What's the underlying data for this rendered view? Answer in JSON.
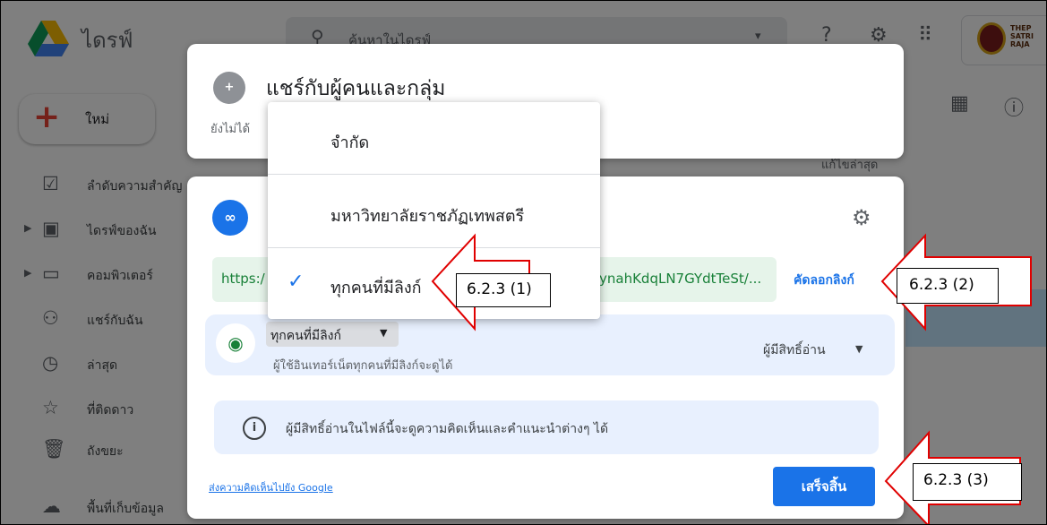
{
  "drive": {
    "app_name": "ไดรฟ์",
    "search_placeholder": "ค้นหาในไดรฟ์",
    "new_button": "ใหม่",
    "university_logo": "เทพสตรี THEPSATRI RAJABHAT UNIVERSITY",
    "sidebar": [
      {
        "label": "ลำดับความสำคัญ",
        "icon": "priority-icon"
      },
      {
        "label": "ไดรฟ์ของฉัน",
        "icon": "my-drive-icon"
      },
      {
        "label": "คอมพิวเตอร์",
        "icon": "computer-icon"
      },
      {
        "label": "แชร์กับฉัน",
        "icon": "shared-icon"
      },
      {
        "label": "ล่าสุด",
        "icon": "clock-icon"
      },
      {
        "label": "ที่ติดดาว",
        "icon": "star-icon"
      },
      {
        "label": "ถังขยะ",
        "icon": "trash-icon"
      },
      {
        "label": "พื้นที่เก็บข้อมูล",
        "icon": "cloud-icon"
      }
    ],
    "column_header": "แก้ไขล่าสุด"
  },
  "share_dialog": {
    "title": "แชร์กับผู้คนและกลุ่ม",
    "subtitle": "ยังไม่ได้"
  },
  "link_dialog": {
    "url_start": "https:/",
    "url_end": "ynahKdqLN7GYdtTeSt/...",
    "copy_link": "คัดลอกลิงก์",
    "access_chip": "ทุกคนที่มีลิงก์",
    "access_description": "ผู้ใช้อินเทอร์เน็ตทุกคนที่มีลิงก์จะดูได้",
    "role": "ผู้มีสิทธิ์อ่าน",
    "info_text": "ผู้มีสิทธิ์อ่านในไฟล์นี้จะดูความคิดเห็นและคำแนะนำต่างๆ ได้",
    "feedback_link": "ส่งความคิดเห็นไปยัง Google",
    "done_button": "เสร็จสิ้น"
  },
  "access_menu": {
    "items": [
      {
        "label": "จำกัด",
        "selected": false
      },
      {
        "label": "มหาวิทยาลัยราชภัฏเทพสตรี",
        "selected": false
      },
      {
        "label": "ทุกคนที่มีลิงก์",
        "selected": true
      }
    ]
  },
  "callouts": [
    "6.2.3 (1)",
    "6.2.3 (2)",
    "6.2.3 (3)"
  ],
  "colors": {
    "accent": "#1a73e8",
    "link_green": "#188038",
    "callout_red": "#e00000"
  }
}
